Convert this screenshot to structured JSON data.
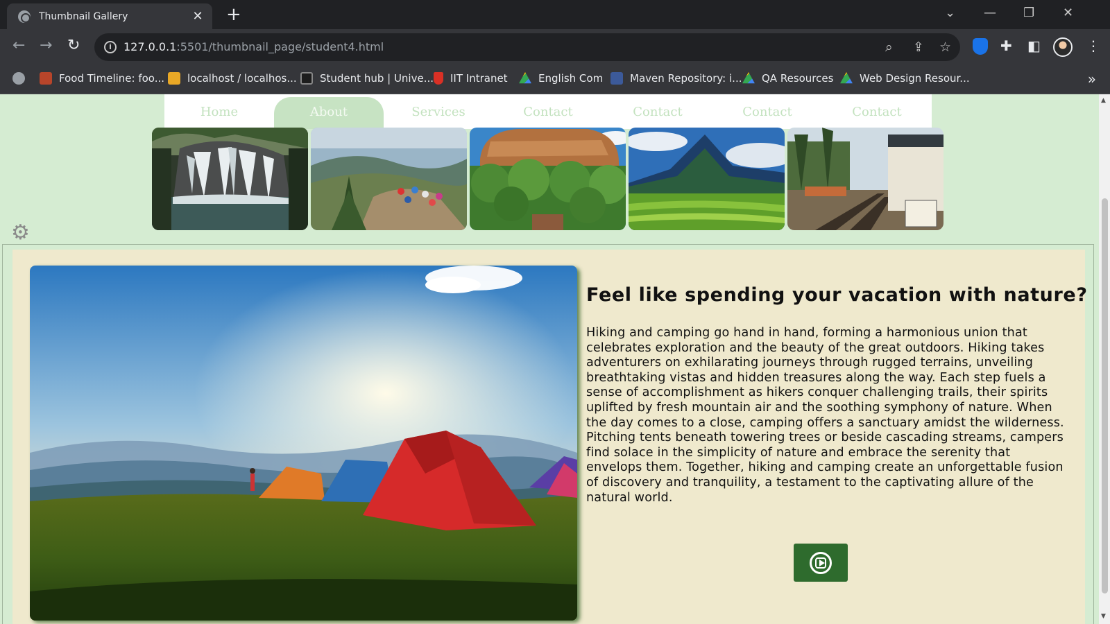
{
  "browser": {
    "tab_title": "Thumbnail Gallery",
    "url_host": "127.0.0.1",
    "url_rest": ":5501/thumbnail_page/student4.html",
    "bookmarks": [
      {
        "label": "Food Timeline: foo...",
        "icon": "ft-icon",
        "color": "#b8452a"
      },
      {
        "label": "localhost / localhos...",
        "icon": "phpmyadmin-icon",
        "color": "#e9a826"
      },
      {
        "label": "Student hub | Unive...",
        "icon": "grid-icon",
        "color": "#222222"
      },
      {
        "label": "IIT Intranet",
        "icon": "shield-icon",
        "color": "#d93025"
      },
      {
        "label": "English Com",
        "icon": "drive-icon",
        "color": "#34a853"
      },
      {
        "label": "Maven Repository: i...",
        "icon": "maven-icon",
        "color": "#3c5a9a"
      },
      {
        "label": "QA Resources",
        "icon": "drive-icon",
        "color": "#34a853"
      },
      {
        "label": "Web Design Resour...",
        "icon": "drive-icon",
        "color": "#34a853"
      }
    ]
  },
  "nav": {
    "items": [
      "Home",
      "About",
      "Services",
      "Contact",
      "Contact",
      "Contact",
      "Contact"
    ],
    "active_index": 1
  },
  "thumbnails": [
    "waterfall",
    "hikers",
    "rock-fortress",
    "mountain",
    "railway-station"
  ],
  "content": {
    "headline": "Feel like spending your vacation with nature?",
    "body": "Hiking and camping go hand in hand, forming a harmonious union that celebrates exploration and the beauty of the great outdoors. Hiking takes adventurers on exhilarating journeys through rugged terrains, unveiling breathtaking vistas and hidden treasures along the way. Each step fuels a sense of accomplishment as hikers conquer challenging trails, their spirits uplifted by fresh mountain air and the soothing symphony of nature. When the day comes to a close, camping offers a sanctuary amidst the wilderness. Pitching tents beneath towering trees or beside cascading streams, campers find solace in the simplicity of nature and embrace the serenity that envelops them. Together, hiking and camping create an unforgettable fusion of discovery and tranquility, a testament to the captivating allure of the natural world."
  },
  "colors": {
    "page_bg": "#d5ecd2",
    "panel_bg": "#efe9cd",
    "nav_text": "#c3e2bf",
    "button_bg": "#2e6b2d"
  }
}
